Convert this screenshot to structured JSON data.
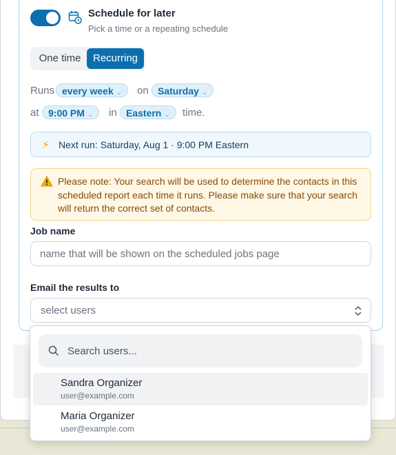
{
  "schedule": {
    "toggle_on": true,
    "title": "Schedule for later",
    "subtitle": "Pick a time or a repeating schedule",
    "modes": {
      "one_time": "One time",
      "recurring": "Recurring",
      "selected": "Recurring"
    },
    "sentence": {
      "runs": "Runs",
      "frequency": "every week",
      "on": "on",
      "day": "Saturday",
      "at": "at",
      "time": "9:00 PM",
      "in": "in",
      "timezone": "Eastern",
      "time_suffix": "time."
    },
    "next_run": "Next run: Saturday, Aug 1 · 9:00 PM Eastern",
    "note": "Please note: Your search will be used to determine the contacts in this scheduled report each time it runs. Please make sure that your search will return the correct set of contacts."
  },
  "job_name": {
    "label": "Job name",
    "value": "",
    "placeholder": "name that will be shown on the scheduled jobs page"
  },
  "email": {
    "label": "Email the results to",
    "placeholder": "select users"
  },
  "dropdown": {
    "search_placeholder": "Search users...",
    "users": [
      {
        "name": "Sandra Organizer",
        "email": "user@example.com",
        "highlighted": true
      },
      {
        "name": "Maria Organizer",
        "email": "user@example.com",
        "highlighted": false
      }
    ]
  },
  "colors": {
    "accent": "#0b6fae",
    "note_bg": "#fff8e6",
    "note_text": "#8a4a06",
    "info_bg": "#f0f8fd"
  },
  "icons": {
    "calendar": "calendar-clock-icon",
    "chevron": "chevron-down-icon",
    "bolt": "lightning-icon",
    "warning": "warning-icon",
    "select": "chevron-up-down-icon",
    "search": "search-icon"
  }
}
